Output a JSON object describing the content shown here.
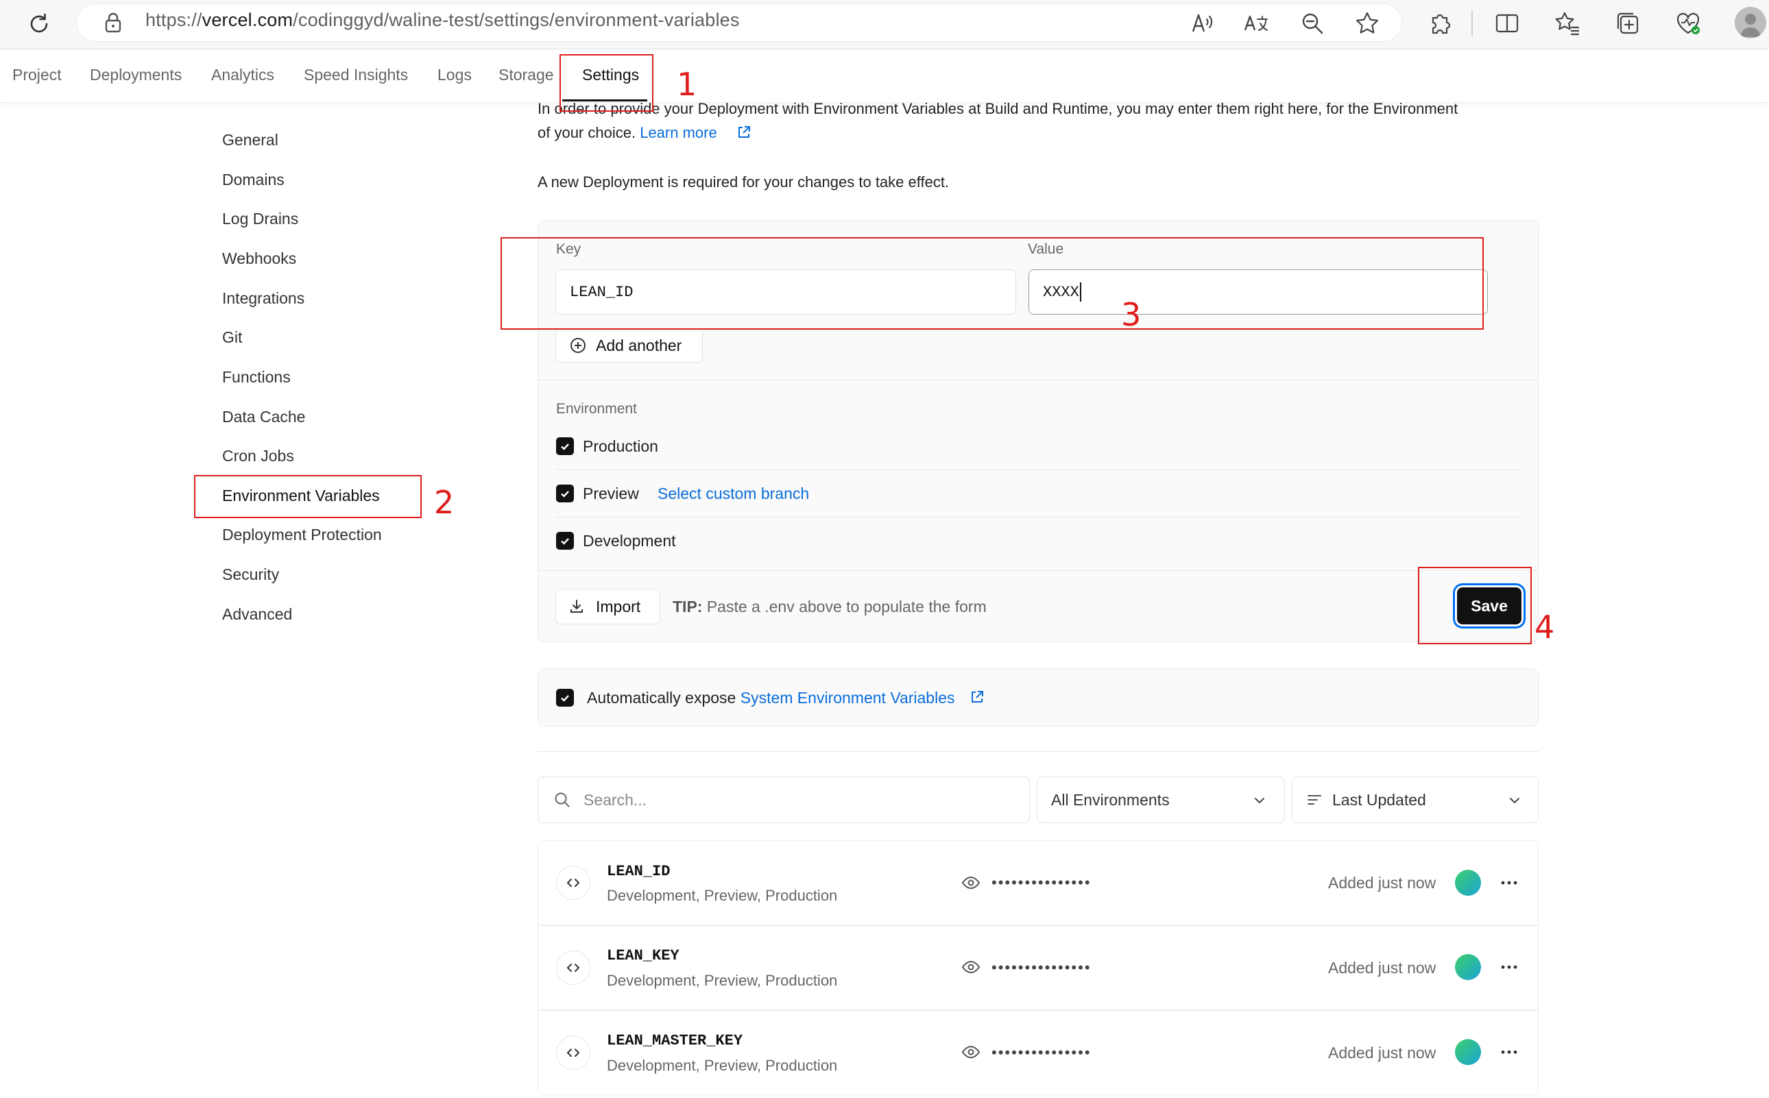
{
  "browser": {
    "url_prefix": "https://",
    "url_domain": "vercel.com",
    "url_path": "/codinggyd/waline-test/settings/environment-variables"
  },
  "nav": {
    "tabs": [
      "Project",
      "Deployments",
      "Analytics",
      "Speed Insights",
      "Logs",
      "Storage",
      "Settings"
    ],
    "active": "Settings"
  },
  "sidebar": {
    "items": [
      "General",
      "Domains",
      "Log Drains",
      "Webhooks",
      "Integrations",
      "Git",
      "Functions",
      "Data Cache",
      "Cron Jobs",
      "Environment Variables",
      "Deployment Protection",
      "Security",
      "Advanced"
    ],
    "active": "Environment Variables"
  },
  "annotations": [
    "1",
    "2",
    "3",
    "4"
  ],
  "intro": {
    "line1": "In order to provide your Deployment with Environment Variables at Build and Runtime, you may enter them right here, for the Environment",
    "line2": "of your choice.",
    "learn_more": "Learn more",
    "notice": "A new Deployment is required for your changes to take effect."
  },
  "form": {
    "key_label": "Key",
    "value_label": "Value",
    "key_value": "LEAN_ID",
    "value_value": "XXXX",
    "add_another": "Add another",
    "environment_label": "Environment",
    "environments": [
      {
        "label": "Production",
        "checked": true
      },
      {
        "label": "Preview",
        "checked": true,
        "link": "Select custom branch"
      },
      {
        "label": "Development",
        "checked": true
      }
    ],
    "import_label": "Import",
    "tip_label": "TIP:",
    "tip_text": "Paste a .env above to populate the form",
    "save_label": "Save"
  },
  "auto_expose": {
    "text": "Automatically expose",
    "link": "System Environment Variables",
    "checked": true
  },
  "filters": {
    "search_placeholder": "Search...",
    "environment_select": "All Environments",
    "sort_select": "Last Updated"
  },
  "variables": [
    {
      "key": "LEAN_ID",
      "environments": "Development, Preview, Production",
      "masked": "•••••••••••••••",
      "updated": "Added just now"
    },
    {
      "key": "LEAN_KEY",
      "environments": "Development, Preview, Production",
      "masked": "•••••••••••••••",
      "updated": "Added just now"
    },
    {
      "key": "LEAN_MASTER_KEY",
      "environments": "Development, Preview, Production",
      "masked": "•••••••••••••••",
      "updated": "Added just now"
    }
  ],
  "colors": {
    "annotation_red": "#e01c1c",
    "link_blue": "#0a6ddb",
    "save_bg": "#111111",
    "focus_ring": "#0070f3"
  }
}
